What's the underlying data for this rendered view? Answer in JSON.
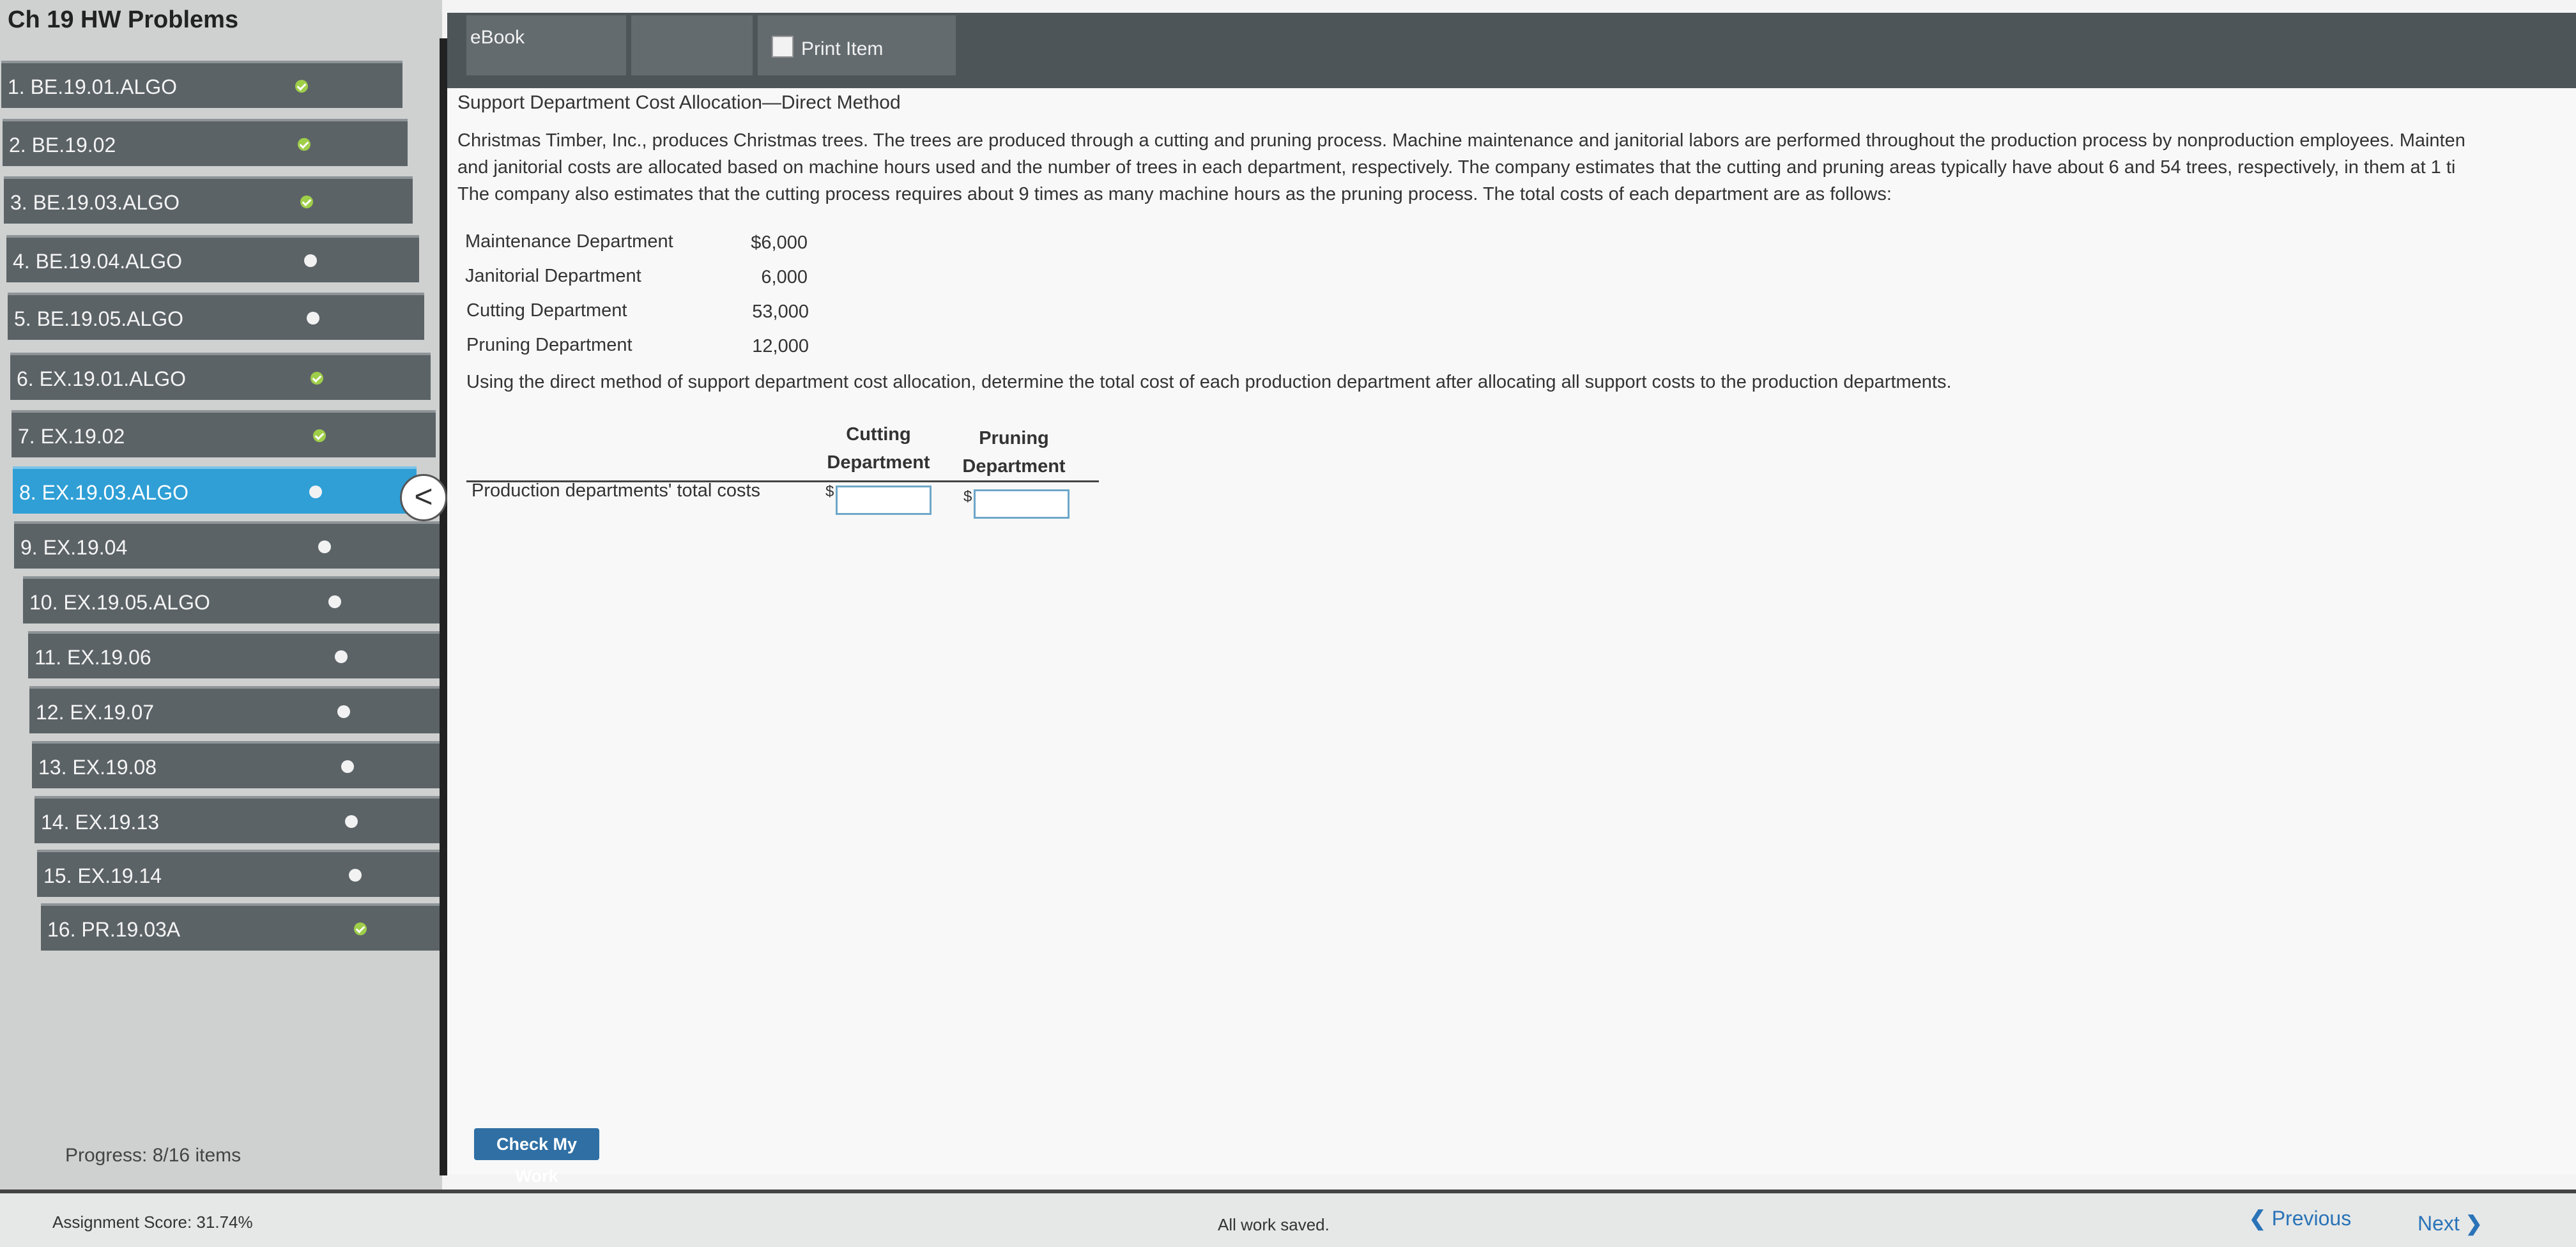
{
  "sidebar": {
    "title": "Ch 19 HW Problems",
    "items": [
      {
        "label": "1. BE.19.01.ALGO",
        "status": "check"
      },
      {
        "label": "2. BE.19.02",
        "status": "check"
      },
      {
        "label": "3. BE.19.03.ALGO",
        "status": "check"
      },
      {
        "label": "4. BE.19.04.ALGO",
        "status": "dot"
      },
      {
        "label": "5. BE.19.05.ALGO",
        "status": "dot"
      },
      {
        "label": "6. EX.19.01.ALGO",
        "status": "check"
      },
      {
        "label": "7. EX.19.02",
        "status": "check"
      },
      {
        "label": "8. EX.19.03.ALGO",
        "status": "dot",
        "active": true
      },
      {
        "label": "9. EX.19.04",
        "status": "dot"
      },
      {
        "label": "10. EX.19.05.ALGO",
        "status": "dot"
      },
      {
        "label": "11. EX.19.06",
        "status": "dot"
      },
      {
        "label": "12. EX.19.07",
        "status": "dot"
      },
      {
        "label": "13. EX.19.08",
        "status": "dot"
      },
      {
        "label": "14. EX.19.13",
        "status": "dot"
      },
      {
        "label": "15. EX.19.14",
        "status": "dot"
      },
      {
        "label": "16. PR.19.03A",
        "status": "check"
      }
    ],
    "progress": "Progress: 8/16 items",
    "collapse_glyph": "<"
  },
  "tabs": {
    "ebook": "eBook",
    "print": "Print Item"
  },
  "problem": {
    "title": "Support Department Cost Allocation—Direct Method",
    "paragraph": [
      "Christmas Timber, Inc., produces Christmas trees. The trees are produced through a cutting and pruning process. Machine maintenance and janitorial labors are performed throughout the production process by nonproduction employees. Mainten",
      "and janitorial costs are allocated based on machine hours used and the number of trees in each department, respectively. The company estimates that the cutting and pruning areas typically have about 6 and 54 trees, respectively, in them at 1 ti",
      "The company also estimates that the cutting process requires about 9 times as many machine hours as the pruning process. The total costs of each department are as follows:"
    ],
    "costs": [
      {
        "dept": "Maintenance Department",
        "amount": "$6,000"
      },
      {
        "dept": "Janitorial Department",
        "amount": "6,000"
      },
      {
        "dept": "Cutting Department",
        "amount": "53,000"
      },
      {
        "dept": "Pruning Department",
        "amount": "12,000"
      }
    ],
    "instruction": "Using the direct method of support department cost allocation, determine the total cost of each production department after allocating all support costs to the production departments.",
    "table": {
      "col1": [
        "Cutting",
        "Department"
      ],
      "col2": [
        "Pruning",
        "Department"
      ],
      "row_label": "Production departments' total costs",
      "currency": "$",
      "cutting_value": "",
      "pruning_value": ""
    }
  },
  "check_button": "Check My Work",
  "footer": {
    "score": "Assignment Score: 31.74%",
    "saved": "All work saved.",
    "previous": "Previous",
    "next": "Next"
  },
  "colors": {
    "active": "#2f9fd6",
    "check": "#9fce49",
    "sidebar_item": "#5c6367"
  }
}
